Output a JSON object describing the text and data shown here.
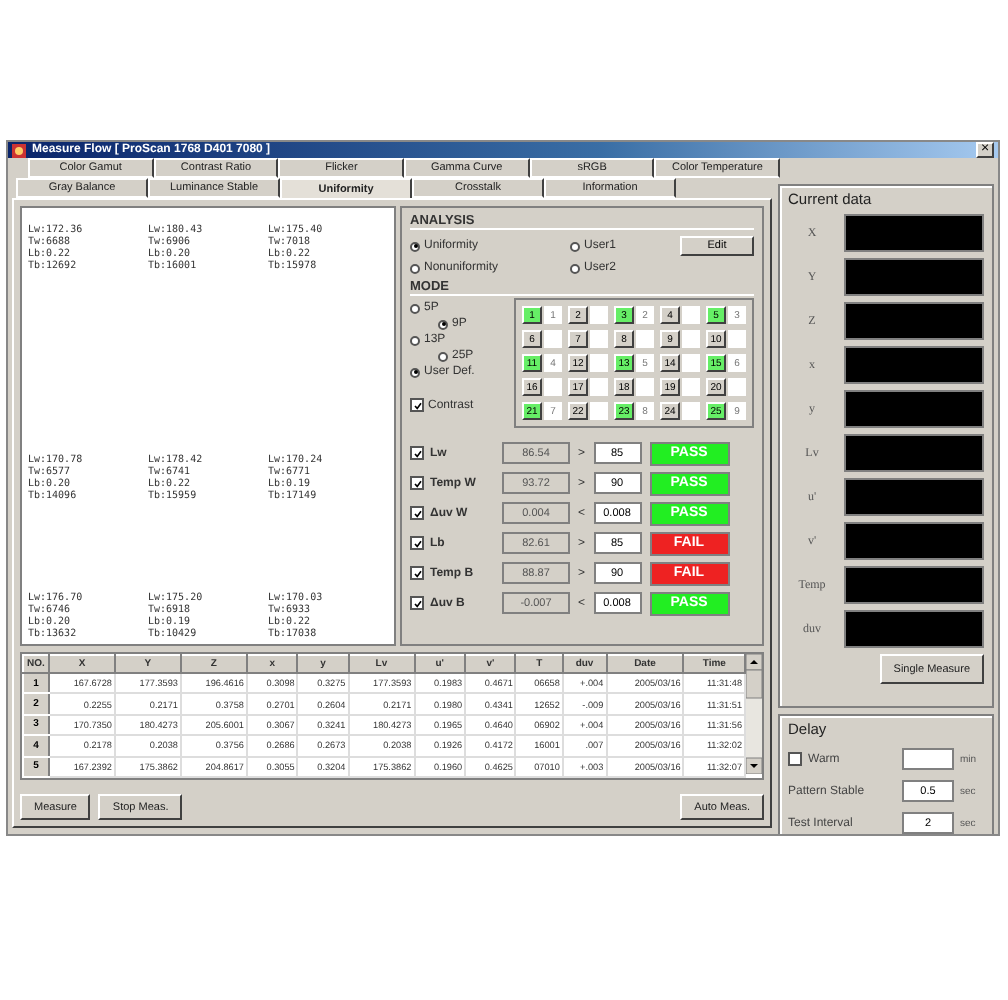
{
  "window": {
    "title": "Measure Flow [ ProScan 1768   D401 7080 ]",
    "close": "×"
  },
  "tabs_top": [
    {
      "label": "Color Gamut",
      "selected": false
    },
    {
      "label": "Contrast Ratio",
      "selected": false
    },
    {
      "label": "Flicker",
      "selected": false
    },
    {
      "label": "Gamma Curve",
      "selected": false
    },
    {
      "label": "sRGB",
      "selected": false
    },
    {
      "label": "Color Temperature",
      "selected": false
    }
  ],
  "tabs_bottom": [
    {
      "label": "Gray Balance",
      "selected": false
    },
    {
      "label": "Luminance Stable",
      "selected": false
    },
    {
      "label": "Uniformity",
      "selected": true
    },
    {
      "label": "Crosstalk",
      "selected": false
    },
    {
      "label": "Information",
      "selected": false
    }
  ],
  "uniformity_points": [
    [
      "Lw:172.36",
      "Tw:6688",
      "Lb:0.22",
      "Tb:12692"
    ],
    [
      "Lw:180.43",
      "Tw:6906",
      "Lb:0.20",
      "Tb:16001"
    ],
    [
      "Lw:175.40",
      "Tw:7018",
      "Lb:0.22",
      "Tb:15978"
    ],
    [
      "Lw:170.78",
      "Tw:6577",
      "Lb:0.20",
      "Tb:14096"
    ],
    [
      "Lw:178.42",
      "Tw:6741",
      "Lb:0.22",
      "Tb:15959"
    ],
    [
      "Lw:170.24",
      "Tw:6771",
      "Lb:0.19",
      "Tb:17149"
    ],
    [
      "Lw:176.70",
      "Tw:6746",
      "Lb:0.20",
      "Tb:13632"
    ],
    [
      "Lw:175.20",
      "Tw:6918",
      "Lb:0.19",
      "Tb:10429"
    ],
    [
      "Lw:170.03",
      "Tw:6933",
      "Lb:0.22",
      "Tb:17038"
    ]
  ],
  "analysis": {
    "title": "ANALYSIS",
    "options": [
      {
        "label": "Uniformity",
        "selected": true
      },
      {
        "label": "User1",
        "selected": false
      },
      {
        "label": "Nonuniformity",
        "selected": false
      },
      {
        "label": "User2",
        "selected": false
      }
    ],
    "edit_button": "Edit"
  },
  "mode": {
    "title": "MODE",
    "options": [
      {
        "label": "5P",
        "selected": false
      },
      {
        "label": "9P",
        "selected": true
      },
      {
        "label": "13P",
        "selected": false
      },
      {
        "label": "25P",
        "selected": false
      },
      {
        "label": "User Def.",
        "selected": true
      }
    ],
    "contrast": {
      "label": "Contrast",
      "checked": true
    },
    "points": [
      {
        "label": "1",
        "selected": true,
        "order": "1"
      },
      {
        "label": "2",
        "selected": false
      },
      {
        "label": "3",
        "selected": true,
        "order": "2"
      },
      {
        "label": "4",
        "selected": false
      },
      {
        "label": "5",
        "selected": true,
        "order": "3"
      },
      {
        "label": "6",
        "selected": false
      },
      {
        "label": "7",
        "selected": false
      },
      {
        "label": "8",
        "selected": false
      },
      {
        "label": "9",
        "selected": false
      },
      {
        "label": "10",
        "selected": false
      },
      {
        "label": "11",
        "selected": true,
        "order": "4"
      },
      {
        "label": "12",
        "selected": false
      },
      {
        "label": "13",
        "selected": true,
        "order": "5"
      },
      {
        "label": "14",
        "selected": false
      },
      {
        "label": "15",
        "selected": true,
        "order": "6"
      },
      {
        "label": "16",
        "selected": false
      },
      {
        "label": "17",
        "selected": false
      },
      {
        "label": "18",
        "selected": false
      },
      {
        "label": "19",
        "selected": false
      },
      {
        "label": "20",
        "selected": false
      },
      {
        "label": "21",
        "selected": true,
        "order": "7"
      },
      {
        "label": "22",
        "selected": false
      },
      {
        "label": "23",
        "selected": true,
        "order": "8"
      },
      {
        "label": "24",
        "selected": false
      },
      {
        "label": "25",
        "selected": true,
        "order": "9"
      }
    ]
  },
  "criteria": [
    {
      "label": "Lw",
      "checked": true,
      "value": "86.54",
      "op": ">",
      "limit": "85",
      "result": "PASS",
      "pass": true
    },
    {
      "label": "Temp W",
      "checked": true,
      "value": "93.72",
      "op": ">",
      "limit": "90",
      "result": "PASS",
      "pass": true
    },
    {
      "label": "Δuv W",
      "checked": true,
      "value": "0.004",
      "op": "<",
      "limit": "0.008",
      "result": "PASS",
      "pass": true
    },
    {
      "label": "Lb",
      "checked": true,
      "value": "82.61",
      "op": ">",
      "limit": "85",
      "result": "FAIL",
      "pass": false
    },
    {
      "label": "Temp B",
      "checked": true,
      "value": "88.87",
      "op": ">",
      "limit": "90",
      "result": "FAIL",
      "pass": false
    },
    {
      "label": "Δuv B",
      "checked": true,
      "value": "-0.007",
      "op": "<",
      "limit": "0.008",
      "result": "PASS",
      "pass": true
    }
  ],
  "table": {
    "columns": [
      "NO.",
      "X",
      "Y",
      "Z",
      "x",
      "y",
      "Lv",
      "u'",
      "v'",
      "T",
      "duv",
      "Date",
      "Time"
    ],
    "rows": [
      [
        "1",
        "167.6728",
        "177.3593",
        "196.4616",
        "0.3098",
        "0.3275",
        "177.3593",
        "0.1983",
        "0.4671",
        "06658",
        "+.004",
        "2005/03/16",
        "11:31:48"
      ],
      [
        "2",
        "0.2255",
        "0.2171",
        "0.3758",
        "0.2701",
        "0.2604",
        "0.2171",
        "0.1980",
        "0.4341",
        "12652",
        "-.009",
        "2005/03/16",
        "11:31:51"
      ],
      [
        "3",
        "170.7350",
        "180.4273",
        "205.6001",
        "0.3067",
        "0.3241",
        "180.4273",
        "0.1965",
        "0.4640",
        "06902",
        "+.004",
        "2005/03/16",
        "11:31:56"
      ],
      [
        "4",
        "0.2178",
        "0.2038",
        "0.3756",
        "0.2686",
        "0.2673",
        "0.2038",
        "0.1926",
        "0.4172",
        "16001",
        ".007",
        "2005/03/16",
        "11:32:02"
      ],
      [
        "5",
        "167.2392",
        "175.3862",
        "204.8617",
        "0.3055",
        "0.3204",
        "175.3862",
        "0.1960",
        "0.4625",
        "07010",
        "+.003",
        "2005/03/16",
        "11:32:07"
      ]
    ]
  },
  "buttons": {
    "measure": "Measure",
    "stop": "Stop Meas.",
    "auto": "Auto Meas."
  },
  "current_data": {
    "title": "Current data",
    "fields": [
      "X",
      "Y",
      "Z",
      "x",
      "y",
      "Lv",
      "u'",
      "v'",
      "Temp",
      "duv"
    ],
    "button": "Single Measure"
  },
  "delay": {
    "title": "Delay",
    "warm": {
      "label": "Warm",
      "checked": false,
      "unit": "min"
    },
    "pattern_stable": {
      "label": "Pattern Stable",
      "value": "0.5",
      "unit": "sec"
    },
    "test_interval": {
      "label": "Test Interval",
      "value": "2",
      "unit": "sec"
    }
  }
}
